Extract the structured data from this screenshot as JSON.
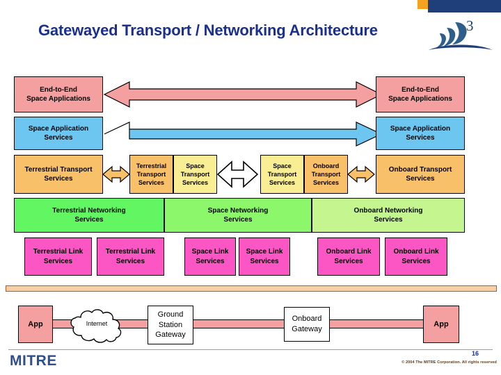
{
  "slide": {
    "title": "Gatewayed Transport / Networking Architecture",
    "page_number": "16",
    "copyright": "© 2004 The MITRE Corporation. All rights reserved",
    "org_logo_text": "MITRE"
  },
  "colors": {
    "title": "#1B2F8C",
    "applications": "#F4A0A0",
    "app_services": "#6CC6F0",
    "transport_dark": "#F9C06A",
    "transport_light": "#FAEE95",
    "networking_terrestrial": "#62F762",
    "networking_space": "#8CF76A",
    "networking_onboard": "#C4F58F",
    "link_services": "#FB56C3",
    "header_orange": "#F5A21E",
    "header_blue": "#1F3F7A",
    "band": "#F6CFA4",
    "band_border": "#B45A28",
    "footer_rule": "#C89A3C",
    "mitre_blue": "#2E4E8F"
  },
  "layers": {
    "applications": [
      {
        "id": "left",
        "label": "End-to-End\nSpace Applications"
      },
      {
        "id": "right",
        "label": "End-to-End\nSpace Applications"
      }
    ],
    "app_services": [
      {
        "id": "left",
        "label": "Space Application\nServices"
      },
      {
        "id": "right",
        "label": "Space Application\nServices"
      }
    ],
    "transport": [
      {
        "id": "terrestrial-transport-left",
        "label": "Terrestrial Transport\nServices",
        "shade": "dark"
      },
      {
        "id": "terrestrial-transport-gw",
        "label": "Terrestrial\nTransport\nServices",
        "shade": "dark"
      },
      {
        "id": "space-transport-gw-left",
        "label": "Space\nTransport\nServices",
        "shade": "light"
      },
      {
        "id": "space-transport-gw-right",
        "label": "Space\nTransport\nServices",
        "shade": "light"
      },
      {
        "id": "onboard-transport-gw",
        "label": "Onboard\nTransport\nServices",
        "shade": "dark"
      },
      {
        "id": "onboard-transport-right",
        "label": "Onboard Transport\nServices",
        "shade": "dark"
      }
    ],
    "networking": [
      {
        "id": "terrestrial-networking",
        "label": "Terrestrial Networking\nServices"
      },
      {
        "id": "space-networking",
        "label": "Space Networking\nServices"
      },
      {
        "id": "onboard-networking",
        "label": "Onboard Networking\nServices"
      }
    ],
    "link": [
      {
        "id": "terrestrial-link-1",
        "label": "Terrestrial Link\nServices"
      },
      {
        "id": "terrestrial-link-2",
        "label": "Terrestrial Link\nServices"
      },
      {
        "id": "space-link-1",
        "label": "Space Link\nServices"
      },
      {
        "id": "space-link-2",
        "label": "Space Link\nServices"
      },
      {
        "id": "onboard-link-1",
        "label": "Onboard Link\nServices"
      },
      {
        "id": "onboard-link-2",
        "label": "Onboard Link\nServices"
      }
    ],
    "physical": [
      {
        "id": "app-left",
        "label": "App"
      },
      {
        "id": "internet",
        "label": "Internet"
      },
      {
        "id": "ground-station",
        "label": "Ground\nStation\nGateway"
      },
      {
        "id": "onboard-gateway",
        "label": "Onboard\nGateway"
      },
      {
        "id": "app-right",
        "label": "App"
      }
    ]
  },
  "arrows": {
    "applications_arrow": {
      "color": "#F4A0A0",
      "direction": "bidirectional"
    },
    "app_services_arrow": {
      "color": "#6CC6F0",
      "direction": "bidirectional"
    },
    "transport_arrows": {
      "color": "#F9C06A",
      "direction": "bidirectional",
      "count": 2
    },
    "gateway_arrows": {
      "color": "#FFFFFF",
      "direction": "bidirectional",
      "count": 2
    }
  }
}
